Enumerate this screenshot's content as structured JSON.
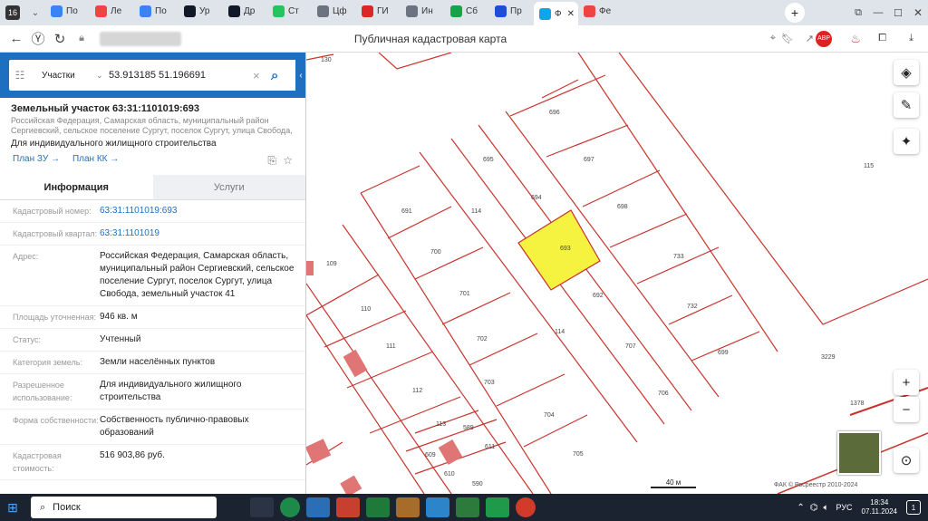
{
  "browser": {
    "tabs": [
      {
        "label": "По",
        "color": "#3b82f6"
      },
      {
        "label": "Ле",
        "color": "#ef4444"
      },
      {
        "label": "По",
        "color": "#3b82f6"
      },
      {
        "label": "Ур",
        "color": "#111827"
      },
      {
        "label": "Др",
        "color": "#111827"
      },
      {
        "label": "Ст",
        "color": "#22c55e"
      },
      {
        "label": "Цф",
        "color": "#6b7280"
      },
      {
        "label": "ГИ",
        "color": "#dc2626"
      },
      {
        "label": "Ин",
        "color": "#6b7280"
      },
      {
        "label": "Сб",
        "color": "#16a34a"
      },
      {
        "label": "Пр",
        "color": "#1d4ed8"
      },
      {
        "label": "Ф",
        "color": "#0ea5e9"
      },
      {
        "label": "Фе",
        "color": "#ef4444"
      }
    ],
    "page_title": "Публичная кадастровая карта"
  },
  "search": {
    "category": "Участки",
    "query": "53.913185 51.196691"
  },
  "parcel": {
    "title": "Земельный участок 63:31:1101019:693",
    "location": "Российская Федерация, Самарская область, муниципальный район Сергиевский, сельское поселение Сургут, поселок Сургут, улица Свобода,",
    "use": "Для индивидуального жилищного строительства",
    "link_zu": "План ЗУ →",
    "link_kk": "План КК →",
    "tab_info": "Информация",
    "tab_services": "Услуги",
    "fields": [
      {
        "k": "Кадастровый номер:",
        "v": "63:31:1101019:693",
        "link": true
      },
      {
        "k": "Кадастровый квартал:",
        "v": "63:31:1101019",
        "link": true
      },
      {
        "k": "Адрес:",
        "v": "Российская Федерация, Самарская область, муниципальный район Сергиевский, сельское поселение Сургут, поселок Сургут, улица Свобода, земельный участок 41",
        "link": false
      },
      {
        "k": "Площадь уточненная:",
        "v": "946 кв. м",
        "link": false
      },
      {
        "k": "Статус:",
        "v": "Учтенный",
        "link": false
      },
      {
        "k": "Категория земель:",
        "v": "Земли населённых пунктов",
        "link": false
      },
      {
        "k": "Разрешенное использование:",
        "v": "Для индивидуального жилищного строительства",
        "link": false
      },
      {
        "k": "Форма собственности:",
        "v": "Собственность публично-правовых образований",
        "link": false
      },
      {
        "k": "Кадастровая стоимость:",
        "v": "516 903,86 руб.",
        "link": false
      }
    ]
  },
  "map": {
    "highlight_color": "#f5f240",
    "labels": [
      "130",
      "696",
      "697",
      "695",
      "694",
      "693",
      "698",
      "115",
      "691",
      "114",
      "700",
      "733",
      "109",
      "701",
      "692",
      "732",
      "110",
      "111",
      "702",
      "707",
      "699",
      "114",
      "704",
      "703",
      "706",
      "3229",
      "112",
      "113",
      "589",
      "611",
      "609",
      "610",
      "590",
      "705",
      "1378"
    ],
    "scale": "40 м",
    "copyright": "ФАК © Росреестр 2010-2024"
  },
  "taskbar": {
    "search_label": "Поиск",
    "lang": "РУС",
    "time": "18:34",
    "date": "07.11.2024"
  }
}
